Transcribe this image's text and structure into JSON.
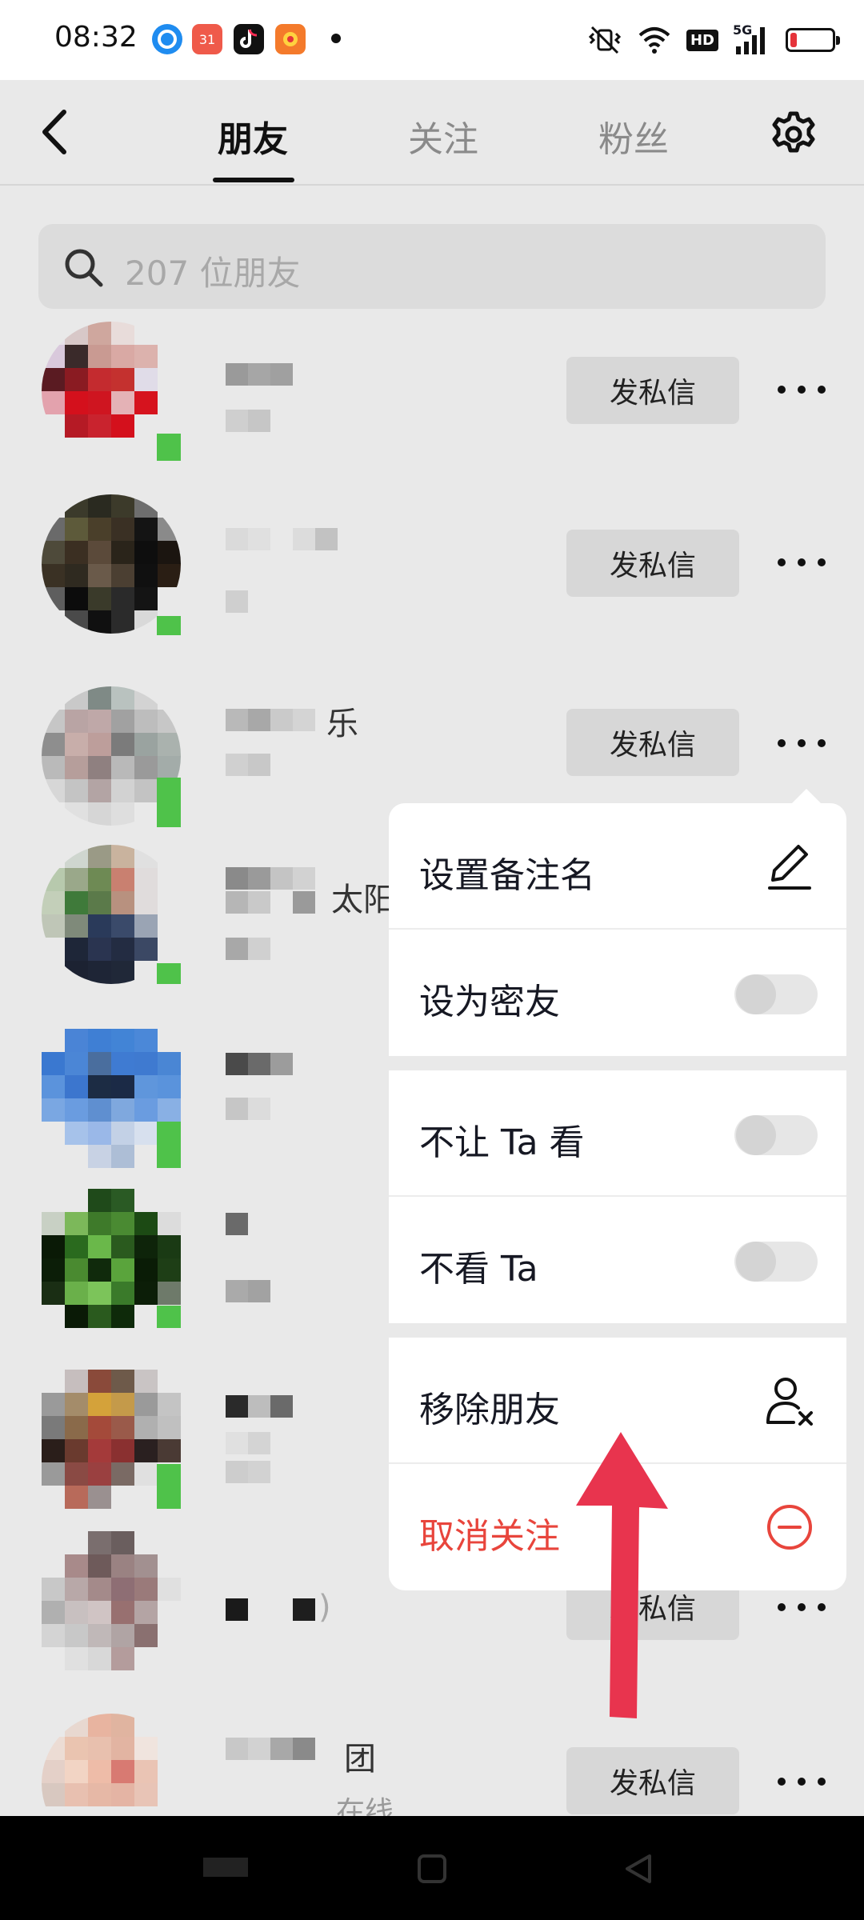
{
  "status_bar": {
    "time": "08:32",
    "calendar_badge": "31",
    "network_label": "HD",
    "signal_label": "5G",
    "battery_level": 0.15,
    "icons": [
      "location-icon",
      "calendar-icon",
      "tiktok-icon",
      "shopping-icon",
      "vibrate-icon",
      "wifi-icon",
      "signal-icon",
      "battery-icon"
    ]
  },
  "header": {
    "tabs": [
      {
        "label": "朋友",
        "active": true
      },
      {
        "label": "关注",
        "active": false
      },
      {
        "label": "粉丝",
        "active": false
      }
    ],
    "back_icon": "chevron-left-icon",
    "settings_icon": "gear-icon"
  },
  "search": {
    "placeholder": "207 位朋友"
  },
  "friends": [
    {
      "name_suffix": "",
      "message_label": "发私信"
    },
    {
      "name_suffix": "",
      "message_label": "发私信"
    },
    {
      "name_suffix": "乐",
      "message_label": "发私信"
    },
    {
      "name_suffix": "太阳",
      "message_label": "发私信"
    },
    {
      "name_suffix": "",
      "message_label": "发私信"
    },
    {
      "name_suffix": "",
      "message_label": "发私信"
    },
    {
      "name_suffix": "",
      "message_label": "发私信"
    },
    {
      "name_suffix": ")",
      "message_label": "发私信"
    },
    {
      "name_suffix": "团",
      "sub_suffix": "在线",
      "message_label": "发私信"
    }
  ],
  "menu": {
    "set_remark": "设置备注名",
    "set_close_friend": "设为密友",
    "hide_from_them": "不让 Ta 看",
    "hide_them": "不看 Ta",
    "remove_friend": "移除朋友",
    "unfollow": "取消关注",
    "toggles": {
      "close_friend": false,
      "hide_from_them": false,
      "hide_them": false
    },
    "icons": [
      "pencil-icon",
      "remove-user-icon",
      "minus-circle-icon"
    ]
  },
  "colors": {
    "danger": "#e8453c",
    "annotation_arrow": "#e8344e",
    "online": "#4fc24a"
  }
}
